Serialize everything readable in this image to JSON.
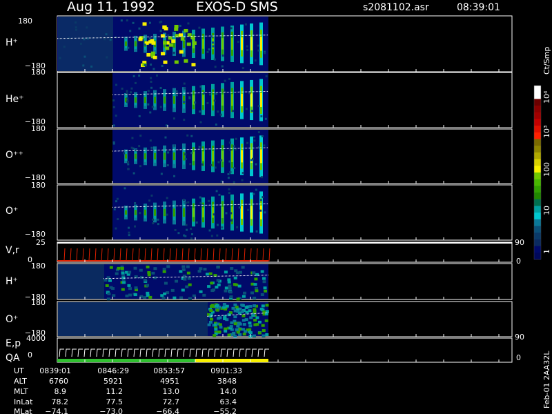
{
  "header": {
    "date": "Aug 11, 1992",
    "instrument": "EXOS-D SMS",
    "file": "s2081102.asr",
    "time": "08:39:01"
  },
  "colorbar": {
    "unit": "Ct/Smp",
    "ticks": [
      "10⁴",
      "10³",
      "100",
      "10",
      "1"
    ],
    "colors": [
      "#ffffff",
      "#ffffff",
      "#6b0000",
      "#8b0000",
      "#a00000",
      "#c40000",
      "#e01000",
      "#ff2000",
      "#7a6a00",
      "#8f8500",
      "#b0a800",
      "#d8d000",
      "#f8f000",
      "#70c800",
      "#48b800",
      "#30a000",
      "#208800",
      "#007050",
      "#00a0a0",
      "#00c8d0",
      "#0a7898",
      "#0a5078",
      "#0a3a68",
      "#0a2a60",
      "#000a6a",
      "#00085a"
    ]
  },
  "chart_data": [
    {
      "type": "heatmap",
      "panel": "H+",
      "ylabel": "H⁺",
      "ytick_labels": [
        "180",
        "−180"
      ],
      "ylim": [
        -180,
        180
      ],
      "x_range": [
        "08:39:01",
        "09:01:33"
      ]
    },
    {
      "type": "heatmap",
      "panel": "He+",
      "ylabel": "He⁺",
      "ytick_labels": [
        "180",
        "−180"
      ],
      "ylim": [
        -180,
        180
      ]
    },
    {
      "type": "heatmap",
      "panel": "O++",
      "ylabel": "O⁺⁺",
      "ytick_labels": [
        "180",
        "−180"
      ],
      "ylim": [
        -180,
        180
      ]
    },
    {
      "type": "heatmap",
      "panel": "O+",
      "ylabel": "O⁺",
      "ytick_labels": [
        "180",
        "−180"
      ],
      "ylim": [
        -180,
        180
      ]
    },
    {
      "type": "line",
      "panel": "V,r",
      "ylabel": "V,r",
      "ytick_labels": [
        "25",
        "0"
      ],
      "ylim": [
        0,
        25
      ],
      "right_tick_labels": [
        "90",
        "0"
      ]
    },
    {
      "type": "heatmap",
      "panel": "H+ (2)",
      "ylabel": "H⁺",
      "ytick_labels": [
        "180",
        "−180"
      ],
      "ylim": [
        -180,
        180
      ]
    },
    {
      "type": "heatmap",
      "panel": "O+ (2)",
      "ylabel": "O⁺",
      "ytick_labels": [
        "180",
        "−180"
      ],
      "ylim": [
        -180,
        180
      ]
    },
    {
      "type": "line",
      "panel": "E,p QA",
      "ylabel": "E,p",
      "ylabel2": "QA",
      "ytick_labels": [
        "4000",
        "0"
      ],
      "ylim": [
        0,
        4000
      ],
      "right_tick_labels": [
        "90",
        "0"
      ]
    }
  ],
  "ephemeris": {
    "row_labels": [
      "UT",
      "ALT",
      "MLT",
      "InLat",
      "MLat"
    ],
    "columns": [
      {
        "UT": "0839:01",
        "ALT": "6760",
        "MLT": "8.9",
        "InLat": "78.2",
        "MLat": "−74.1"
      },
      {
        "UT": "0846:29",
        "ALT": "5921",
        "MLT": "11.2",
        "InLat": "77.5",
        "MLat": "−73.0"
      },
      {
        "UT": "0853:57",
        "ALT": "4951",
        "MLT": "13.0",
        "InLat": "72.7",
        "MLat": "−66.4"
      },
      {
        "UT": "0901:33",
        "ALT": "3848",
        "MLT": "14.0",
        "InLat": "63.4",
        "MLat": "−55.2"
      }
    ]
  },
  "footer": {
    "stamp": "Feb-01 2AA32L"
  }
}
